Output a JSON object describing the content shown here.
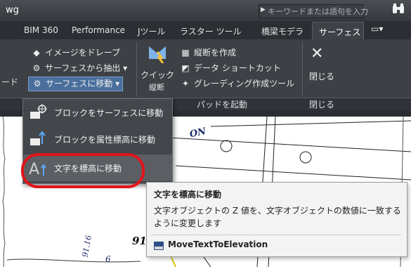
{
  "titlebar": {
    "title": "wg",
    "search_placeholder": "キーワードまたは語句を入力",
    "search_icon": "binoculars-icon"
  },
  "tabs": [
    {
      "label": "BIM 360"
    },
    {
      "label": "Performance"
    },
    {
      "label": "Jツール"
    },
    {
      "label": "ラスター ツール"
    },
    {
      "label": "橋梁モデラ"
    }
  ],
  "active_tab": {
    "label": "サーフェス"
  },
  "extra_tab": {
    "label": "▭▾"
  },
  "ribbon": {
    "left_partial": "ード",
    "buttons": [
      {
        "label": "イメージをドレープ",
        "icon": "drape-icon"
      },
      {
        "label": "サーフェスから抽出",
        "suffix": "▾",
        "icon": "extract-icon"
      },
      {
        "label": "サーフェスに移動",
        "suffix": "▾",
        "icon": "move-to-surface-icon"
      }
    ],
    "quick": {
      "label1": "クイック",
      "label2": "縦断"
    },
    "right_buttons": [
      {
        "label": "縦断を作成",
        "icon": "profile-create-icon"
      },
      {
        "label": "データ ショートカット",
        "icon": "shortcut-icon"
      },
      {
        "label": "グレーディング作成ツール",
        "icon": "grading-icon"
      }
    ],
    "close": {
      "label": "閉じる"
    },
    "panel_title": "パッドを起動",
    "panel_close_title": "閉じる"
  },
  "dropdown": {
    "items": [
      {
        "label": "ブロックをサーフェスに移動",
        "icon": "block-to-surface-icon"
      },
      {
        "label": "ブロックを属性標高に移動",
        "icon": "block-to-elevation-icon"
      },
      {
        "label": "文字を標高に移動",
        "icon": "text-to-elevation-icon"
      }
    ]
  },
  "tooltip": {
    "title": "文字を標高に移動",
    "description": "文字オブジェクトの Z 値を、文字オブジェクトの数値に一致するように変更します",
    "command": "MoveTextToElevation"
  },
  "canvas": {
    "texts": [
      "ON",
      "91",
      "91.16",
      "6"
    ]
  },
  "colors": {
    "highlight_ring": "#e0141b",
    "active_button": "#4a6f9c"
  }
}
